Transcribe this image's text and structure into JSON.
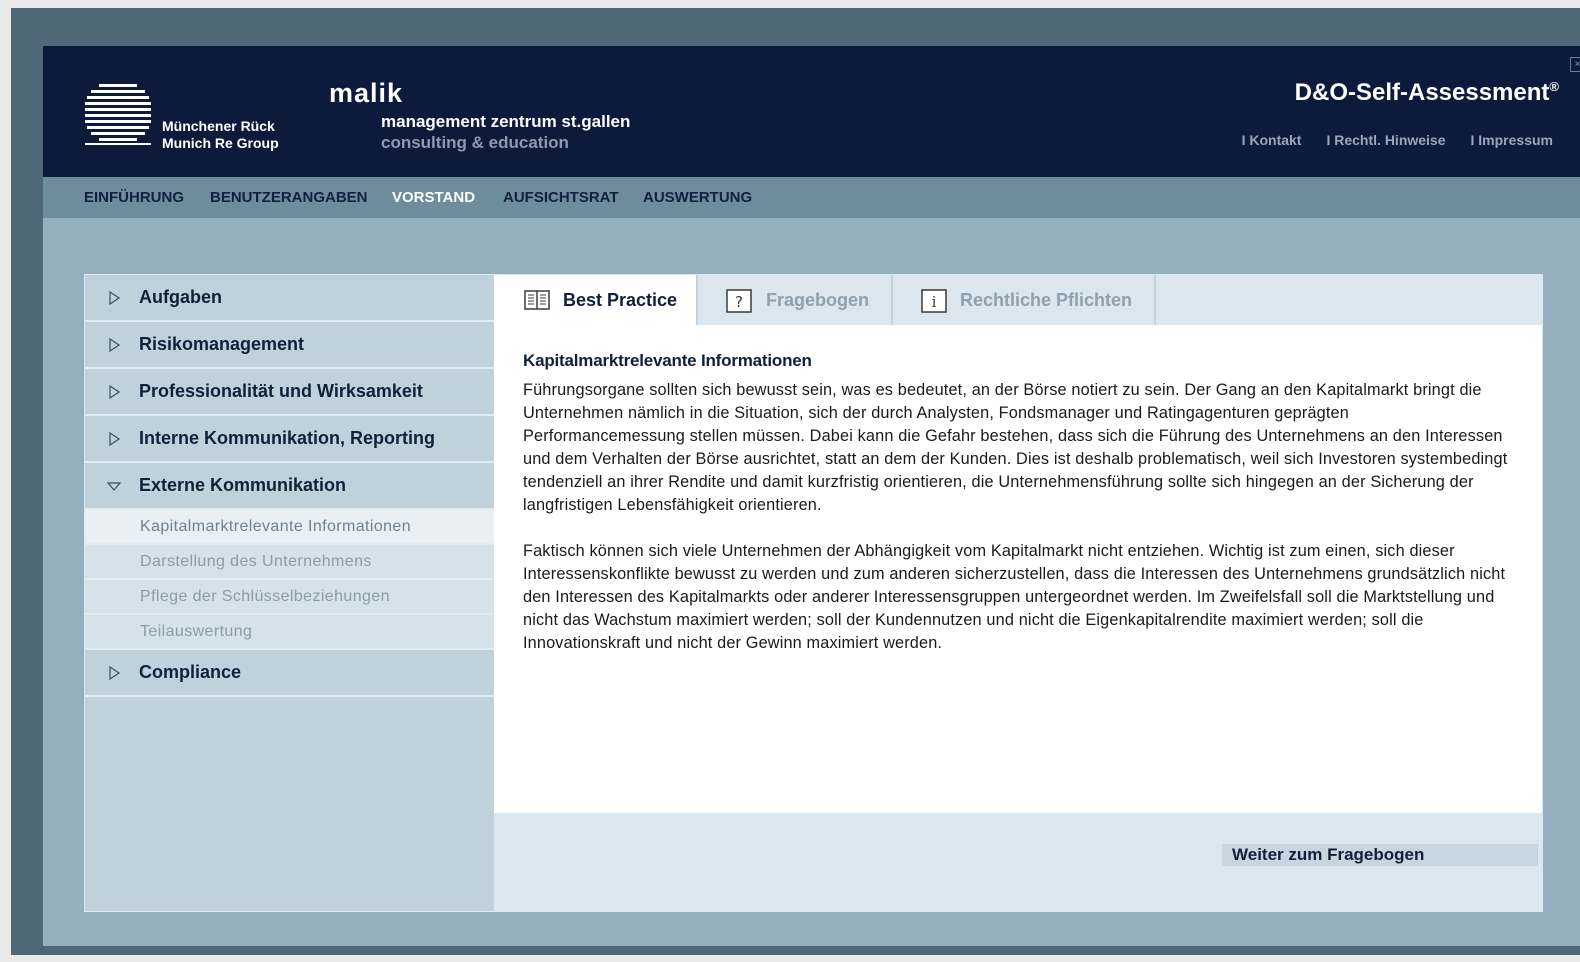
{
  "header": {
    "munich_re_line1": "Münchener Rück",
    "munich_re_line2": "Munich Re Group",
    "malik_name": "malik",
    "malik_line1": "management zentrum st.gallen",
    "malik_line2": "consulting & education",
    "app_title": "D&O-Self-Assessment",
    "app_title_mark": "®",
    "links": [
      "I Kontakt",
      "I Rechtl. Hinweise",
      "I Impressum"
    ],
    "close_glyph": "×"
  },
  "nav": {
    "items": [
      "EINFÜHRUNG",
      "BENUTZERANGABEN",
      "VORSTAND",
      "AUFSICHTSRAT",
      "AUSWERTUNG"
    ],
    "active": "VORSTAND"
  },
  "sidebar": {
    "items": [
      {
        "label": "Aufgaben",
        "expanded": false
      },
      {
        "label": "Risikomanagement",
        "expanded": false
      },
      {
        "label": "Professionalität und Wirksamkeit",
        "expanded": false
      },
      {
        "label": "Interne Kommunikation, Reporting",
        "expanded": false
      },
      {
        "label": "Externe Kommunikation",
        "expanded": true
      },
      {
        "label": "Compliance",
        "expanded": false
      }
    ],
    "subitems": [
      "Kapitalmarktrelevante Informationen",
      "Darstellung des Unternehmens",
      "Pflege der Schlüsselbeziehungen",
      "Teilauswertung"
    ],
    "active_subitem": "Kapitalmarktrelevante Informationen"
  },
  "tabs": [
    {
      "label": "Best Practice",
      "icon": "book-icon",
      "active": true
    },
    {
      "label": "Fragebogen",
      "icon": "question-icon",
      "active": false
    },
    {
      "label": "Rechtliche Pflichten",
      "icon": "info-icon",
      "active": false
    }
  ],
  "content": {
    "title": "Kapitalmarktrelevante Informationen",
    "paragraphs": [
      "Führungsorgane sollten sich bewusst sein, was es bedeutet, an der Börse notiert zu sein. Der Gang an den Kapitalmarkt bringt die Unternehmen nämlich in die Situation, sich der durch Analysten, Fondsmanager und Ratingagenturen geprägten Performancemessung stellen müssen. Dabei kann die Gefahr bestehen, dass sich die Führung des Unternehmens an den Interessen und dem Verhalten der Börse ausrichtet, statt an dem der Kunden. Dies ist deshalb problematisch, weil sich Investoren systembedingt tendenziell an ihrer Rendite und damit kurzfristig orientieren, die Unternehmensführung sollte sich hingegen an der Sicherung der langfristigen Lebensfähigkeit orientieren.",
      "Faktisch können sich viele Unternehmen der Abhängigkeit vom Kapitalmarkt nicht entziehen. Wichtig ist zum einen, sich dieser Interessenskonflikte bewusst zu werden und zum anderen sicherzustellen, dass die Interessen des Unternehmens grundsätzlich nicht den Interessen des Kapitalmarkts oder anderer Interessensgruppen untergeordnet werden. Im Zweifelsfall soll die Marktstellung und nicht das Wachstum maximiert werden; soll der Kundennutzen und nicht die Eigenkapitalrendite maximiert werden; soll die Innovationskraft und nicht der Gewinn maximiert werden."
    ]
  },
  "footer": {
    "next_button": "Weiter zum Fragebogen"
  },
  "colors": {
    "header_bg": "#0d1a3c",
    "nav_bg": "#6d8c9c",
    "sidebar_bg": "#c1d1dc",
    "tab_bar_bg": "#dbe6ee"
  }
}
